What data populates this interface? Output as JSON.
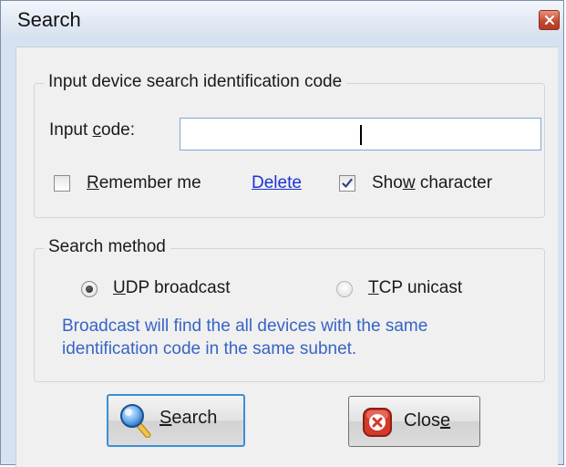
{
  "window": {
    "title": "Search"
  },
  "code_group": {
    "title": "Input device search identification code",
    "input_label_pre": "Input ",
    "input_label_mnemonic": "c",
    "input_label_post": "ode:",
    "input_value": "",
    "remember": {
      "mnemonic": "R",
      "rest": "emember me",
      "checked": false
    },
    "delete_link": "Delete",
    "show_char": {
      "pre": "Sho",
      "mnemonic": "w",
      "post": " character",
      "checked": true
    }
  },
  "method_group": {
    "title": "Search method",
    "udp": {
      "mnemonic": "U",
      "rest": "DP broadcast",
      "selected": true
    },
    "tcp": {
      "mnemonic": "T",
      "rest": "CP unicast",
      "selected": false
    },
    "info_line1": "Broadcast will find the all devices with the same",
    "info_line2": "identification code in the same subnet."
  },
  "buttons": {
    "search": {
      "mnemonic": "S",
      "rest": "earch"
    },
    "close": {
      "pre": "Clos",
      "mnemonic": "e"
    }
  },
  "colors": {
    "link": "#1a34d8",
    "info_text": "#3764c4",
    "focus_border": "#3a8fd8",
    "close_red": "#c4462d"
  },
  "icons": {
    "title_close": "close-x-icon",
    "search_button": "magnifier-icon",
    "close_button": "red-x-icon"
  }
}
